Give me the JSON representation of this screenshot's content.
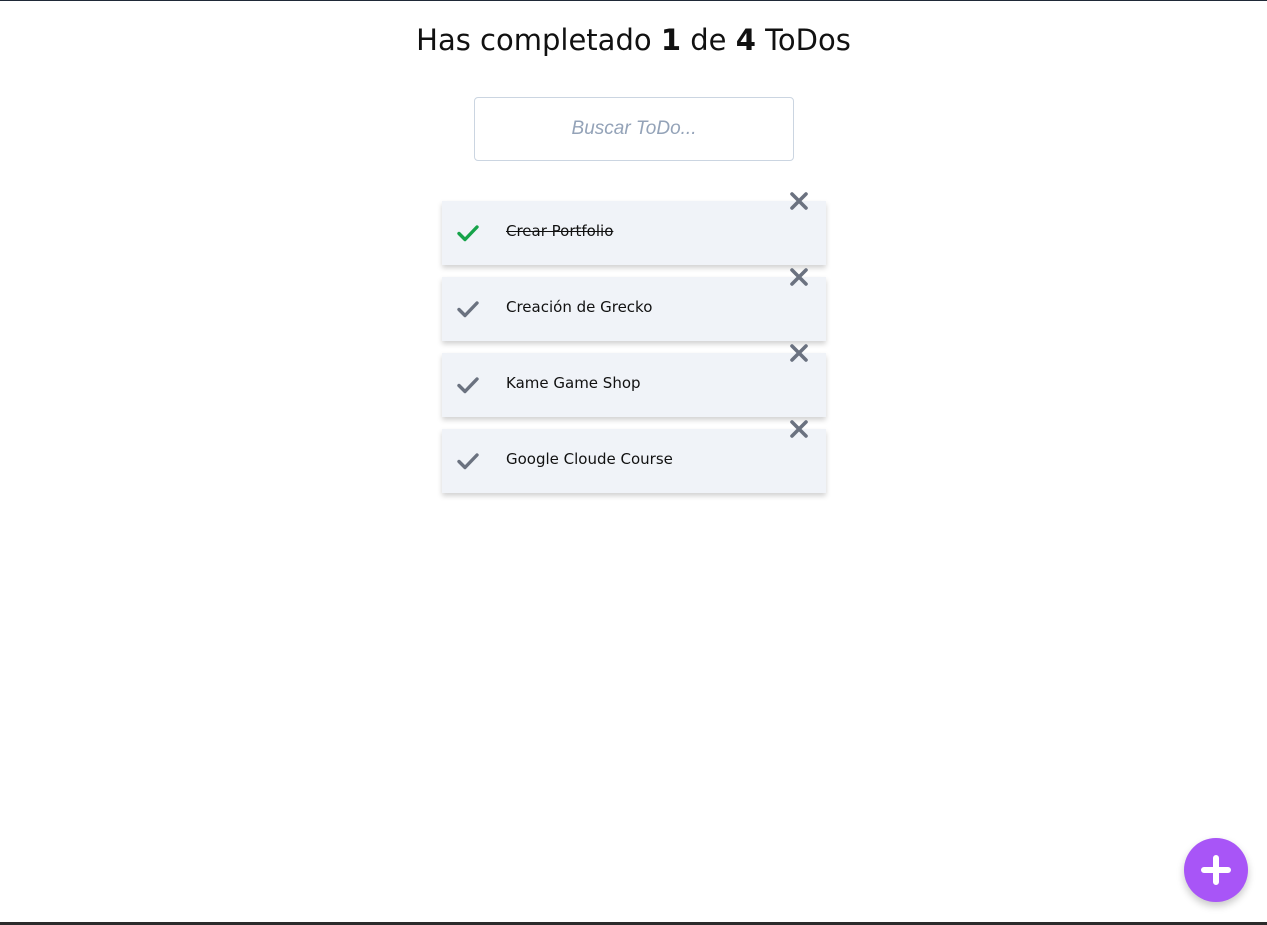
{
  "header": {
    "prefix": "Has completado",
    "completed": "1",
    "middle": "de",
    "total": "4",
    "suffix": "ToDos"
  },
  "search": {
    "placeholder": "Buscar ToDo..."
  },
  "todos": [
    {
      "text": "Crear Portfolio",
      "completed": true
    },
    {
      "text": "Creación de Grecko",
      "completed": false
    },
    {
      "text": "Kame Game Shop",
      "completed": false
    },
    {
      "text": "Google Cloude Course",
      "completed": false
    }
  ],
  "icons": {
    "check": "check-icon",
    "delete": "close-icon",
    "add": "plus-icon"
  },
  "colors": {
    "check_done": "#16a34a",
    "check_pending": "#6b7280",
    "delete": "#6b7280",
    "fab": "#a855f7",
    "item_bg": "#f0f3f8"
  }
}
